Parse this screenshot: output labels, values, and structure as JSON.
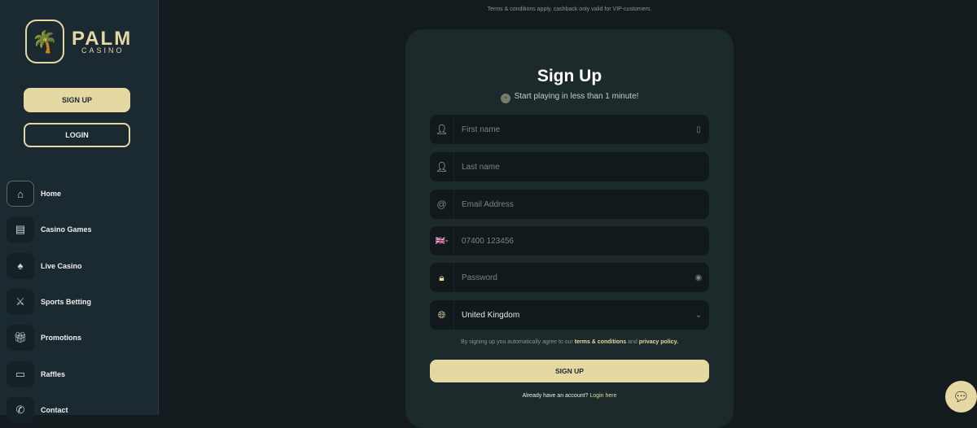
{
  "brand": {
    "name": "PALM",
    "sub": "CASINO",
    "logo_icon": "palm-tree-icon"
  },
  "sidebar": {
    "signup_label": "SIGN UP",
    "login_label": "LOGIN",
    "items": [
      {
        "label": "Home",
        "icon": "home-icon",
        "active": true
      },
      {
        "label": "Casino Games",
        "icon": "slot-machine-icon"
      },
      {
        "label": "Live Casino",
        "icon": "cards-icon"
      },
      {
        "label": "Sports Betting",
        "icon": "sports-icon"
      },
      {
        "label": "Promotions",
        "icon": "gift-icon"
      },
      {
        "label": "Raffles",
        "icon": "ticket-icon"
      },
      {
        "label": "Contact",
        "icon": "phone-icon"
      }
    ]
  },
  "notice": "Terms & conditions apply, cashback only valid for VIP-customers.",
  "form": {
    "title": "Sign Up",
    "subtitle": "Start playing in less than 1 minute!",
    "first_name_placeholder": "First name",
    "last_name_placeholder": "Last name",
    "email_placeholder": "Email Address",
    "phone_placeholder": "07400 123456",
    "phone_flag": "🇬🇧",
    "password_placeholder": "Password",
    "country_value": "United Kingdom",
    "agree_prefix": "By signing up you automatically agree to our ",
    "terms_link": "terms & conditions",
    "agree_and": " and ",
    "privacy_link": "privacy policy.",
    "submit_label": "SIGN UP",
    "have_account": "Already have an account? ",
    "login_link": "Login here"
  },
  "colors": {
    "accent": "#e6d8a3",
    "sidebar": "#1a2a30",
    "background": "#131b1f",
    "card": "#1c2a2b",
    "input": "#11191c"
  }
}
